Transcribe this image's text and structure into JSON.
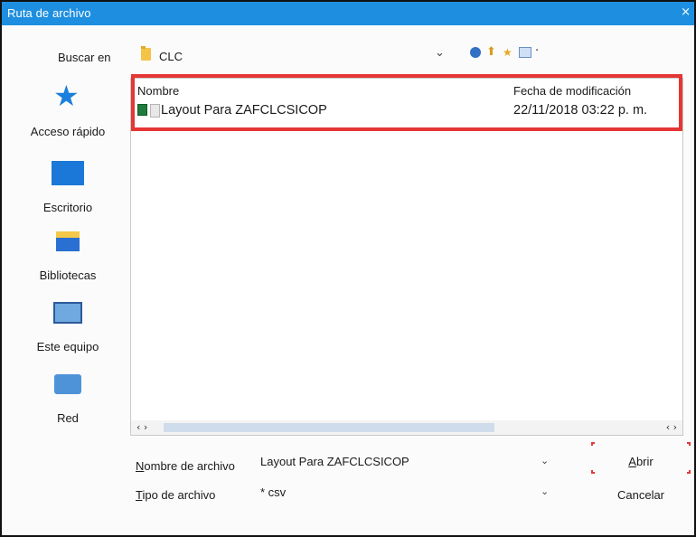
{
  "window": {
    "title": "Ruta de archivo",
    "close_glyph": "×"
  },
  "toolbar": {
    "look_in_label": "Buscar en",
    "look_in_value": "CLC",
    "icons": [
      "back-icon",
      "up-folder-icon",
      "new-folder-icon",
      "view-menu-icon"
    ]
  },
  "places": [
    {
      "label": "Acceso rápido",
      "icon": "star-icon"
    },
    {
      "label": "Escritorio",
      "icon": "desktop-icon"
    },
    {
      "label": "Bibliotecas",
      "icon": "libraries-icon"
    },
    {
      "label": "Este equipo",
      "icon": "computer-icon"
    },
    {
      "label": "Red",
      "icon": "network-icon"
    }
  ],
  "file_list": {
    "columns": [
      "Nombre",
      "Fecha de modificación"
    ],
    "rows": [
      {
        "name": "Layout Para  ZAFCLCSICOP",
        "modified": "22/11/2018 03:22 p. m.",
        "icon": "excel-file-icon"
      }
    ]
  },
  "file_name": {
    "label_pre": "",
    "label_hotkey": "N",
    "label_post": "ombre de archivo",
    "value": "Layout Para  ZAFCLCSICOP"
  },
  "file_type": {
    "label_hotkey": "T",
    "label_post": "ipo de archivo",
    "value": "* csv"
  },
  "buttons": {
    "open_hotkey": "A",
    "open_rest": "brir",
    "cancel": "Cancelar"
  },
  "colors": {
    "title_bar": "#1e8fe0",
    "highlight": "#e53535",
    "accent": "#1b7fde"
  }
}
